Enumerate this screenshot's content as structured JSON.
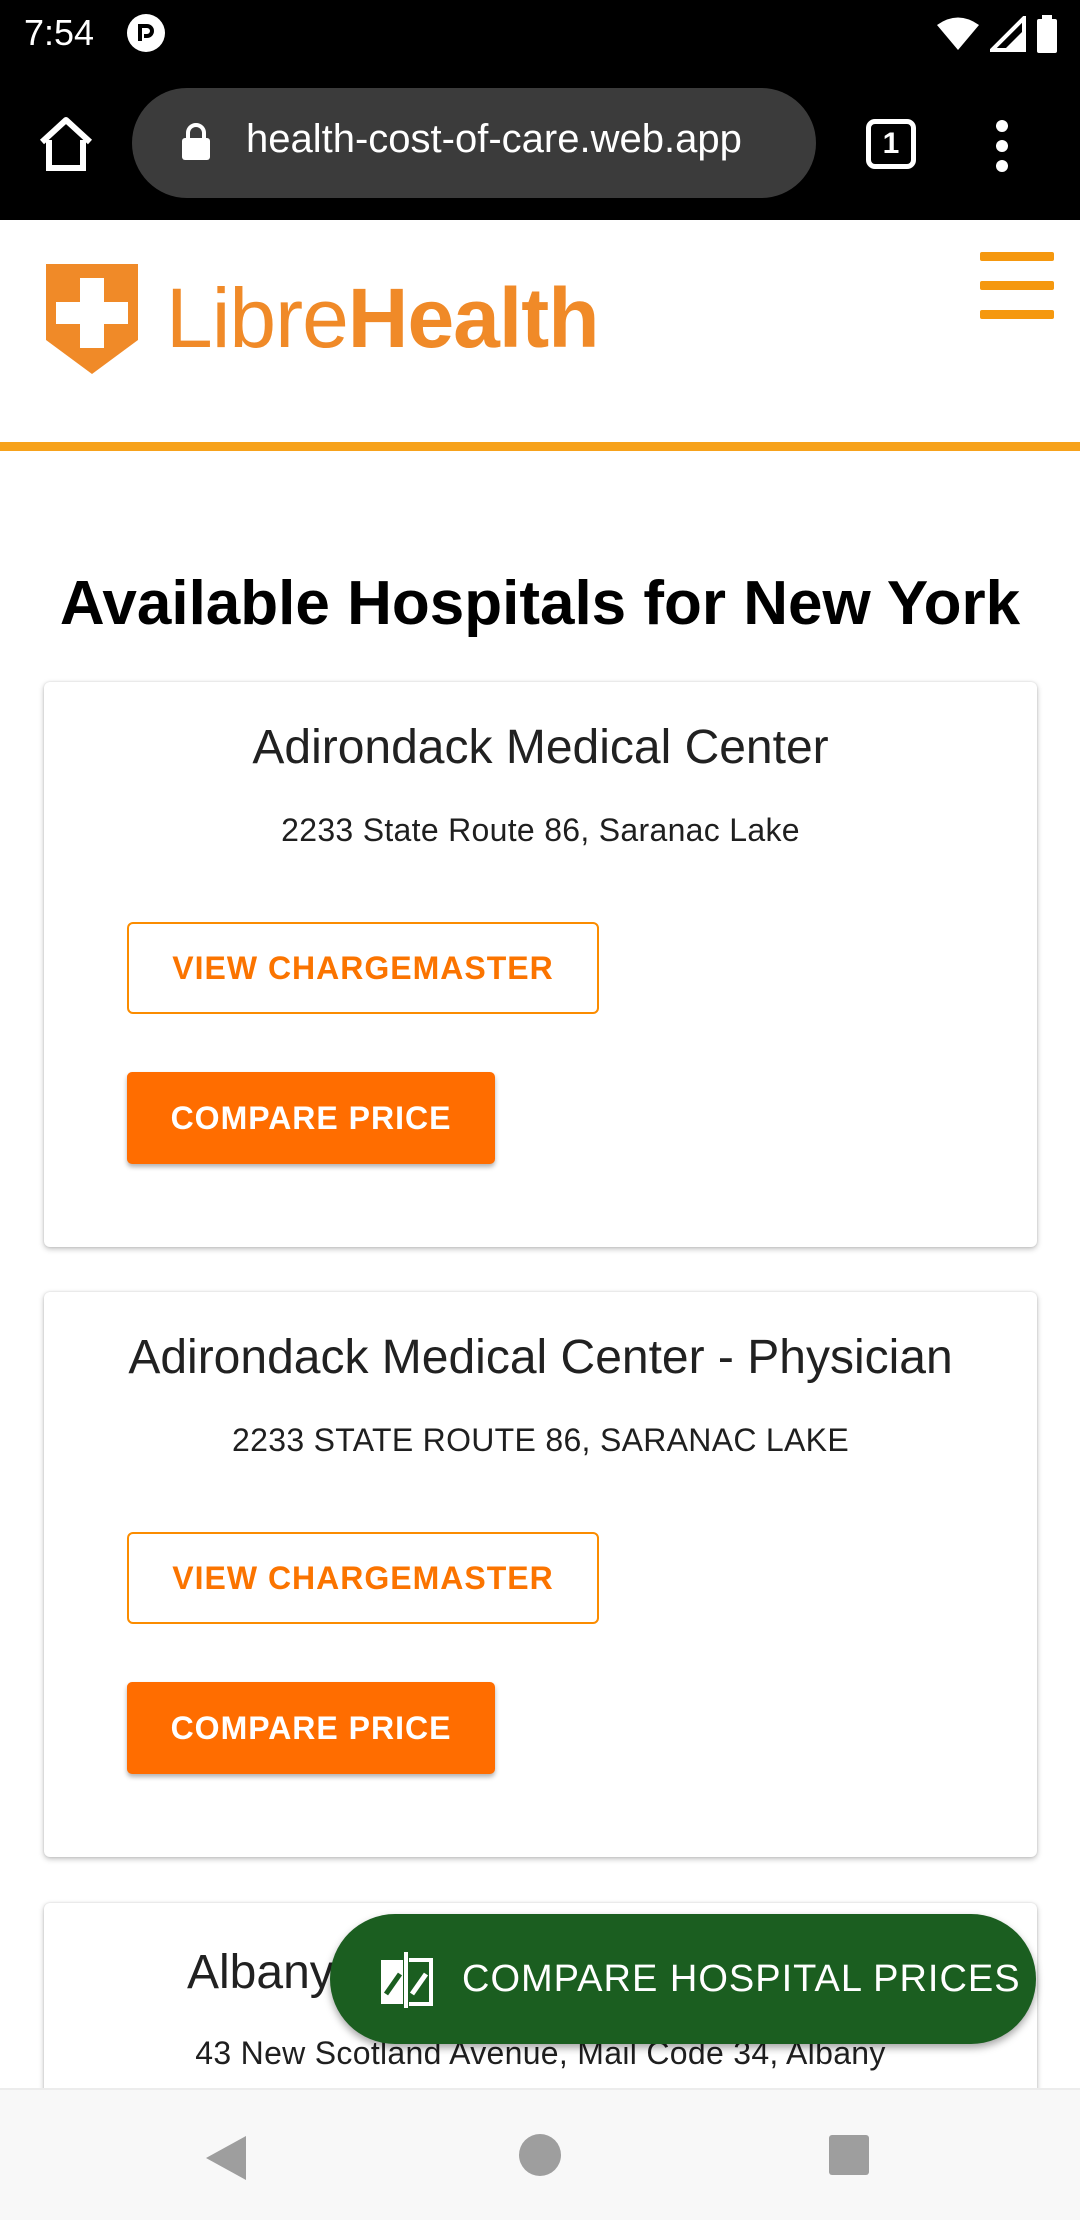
{
  "status_bar": {
    "time": "7:54"
  },
  "browser": {
    "url": "health-cost-of-care.web.app",
    "tab_count": "1"
  },
  "site": {
    "logo_light": "Libre",
    "logo_bold": "Health"
  },
  "page": {
    "title": "Available Hospitals for New York"
  },
  "hospitals": [
    {
      "name": "Adirondack Medical Center",
      "address": "2233 State Route 86, Saranac Lake",
      "view_label": "VIEW CHARGEMASTER",
      "compare_label": "COMPARE PRICE"
    },
    {
      "name": "Adirondack Medical Center - Physician",
      "address": "2233 STATE ROUTE 86, SARANAC LAKE",
      "view_label": "VIEW CHARGEMASTER",
      "compare_label": "COMPARE PRICE"
    },
    {
      "name": "Albany",
      "address": "43 New Scotland Avenue, Mail Code 34, Albany"
    }
  ],
  "fab": {
    "label": "COMPARE HOSPITAL PRICES",
    "icon": "compare-icon"
  },
  "colors": {
    "accent": "#f08a28",
    "header_rule": "#f7a21b",
    "button_orange": "#ff6d00",
    "fab_green": "#1b5e20"
  }
}
